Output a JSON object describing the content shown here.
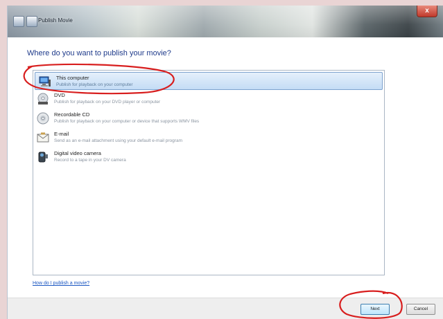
{
  "window": {
    "title": "Publish Movie",
    "close_label": "x"
  },
  "question": "Where do you want to publish your movie?",
  "options": [
    {
      "name": "This computer",
      "description": "Publish for playback on your computer",
      "icon": "computer-icon"
    },
    {
      "name": "DVD",
      "description": "Publish for playback on your DVD player or computer",
      "icon": "dvd-icon"
    },
    {
      "name": "Recordable CD",
      "description": "Publish for playback on your computer or device that supports WMV files",
      "icon": "cd-icon"
    },
    {
      "name": "E-mail",
      "description": "Send as an e-mail attachment using your default e-mail program",
      "icon": "email-icon"
    },
    {
      "name": "Digital video camera",
      "description": "Record to a tape in your DV camera",
      "icon": "camcorder-icon"
    }
  ],
  "help_link": "How do I publish a movie?",
  "buttons": {
    "next": "Next",
    "cancel": "Cancel"
  },
  "colors": {
    "annotation": "#d81e1e",
    "selection": "#c4dcf5",
    "heading": "#1e3a8a"
  }
}
